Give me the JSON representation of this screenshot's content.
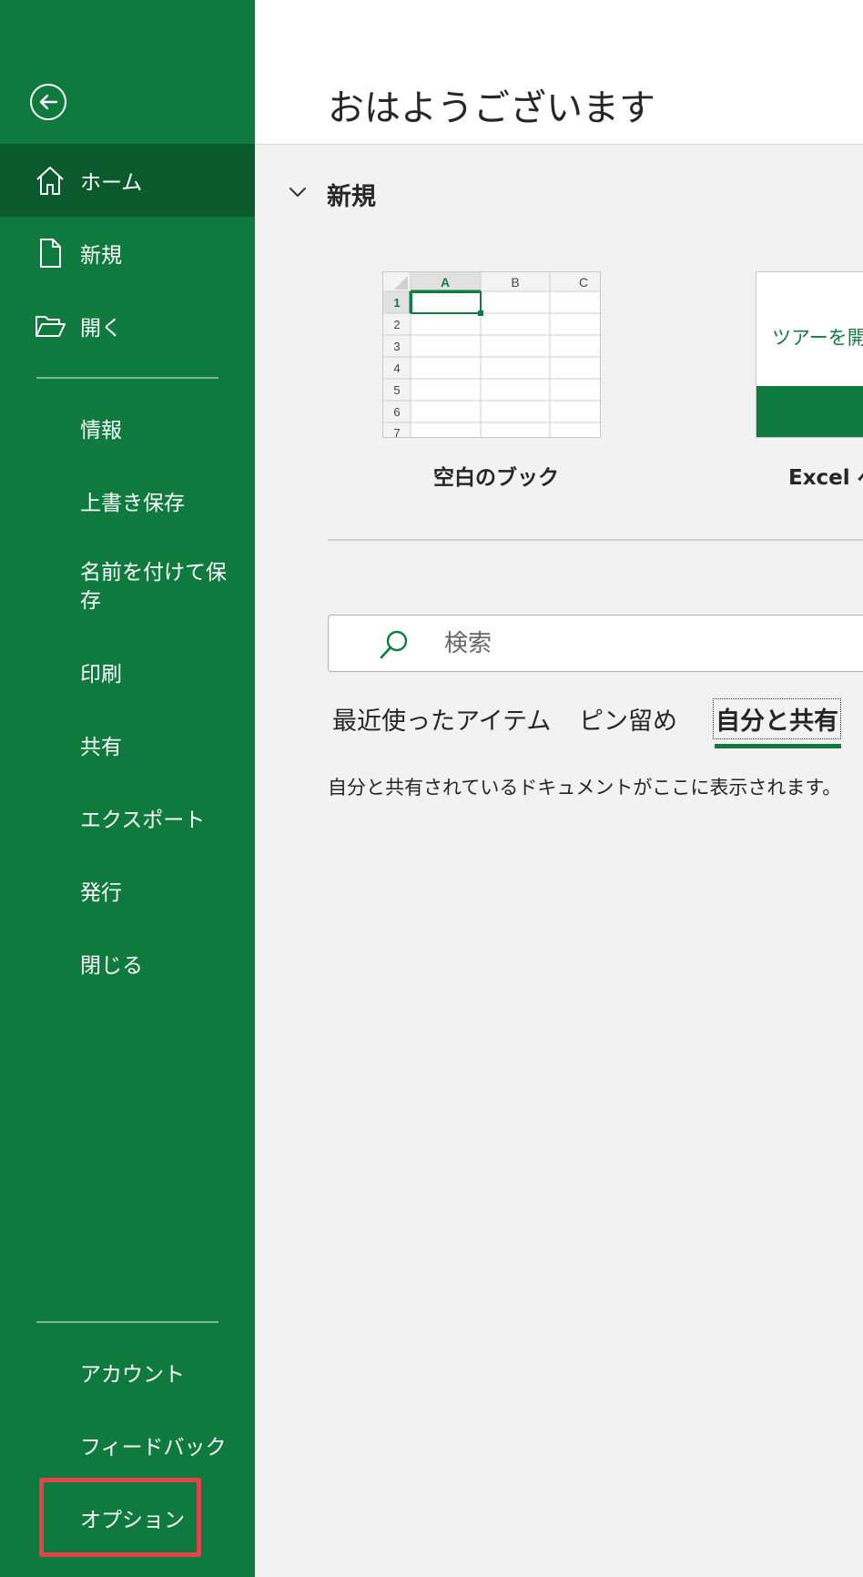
{
  "colors": {
    "sidebar_bg": "#0f7a3e",
    "sidebar_active": "#0a5a2d",
    "accent": "#0f7a3e",
    "highlight_box": "#e5434c"
  },
  "sidebar": {
    "back_icon": "back-arrow-icon",
    "primary_items": [
      {
        "label": "ホーム",
        "icon": "home-icon",
        "active": true
      },
      {
        "label": "新規",
        "icon": "new-document-icon"
      },
      {
        "label": "開く",
        "icon": "open-folder-icon"
      }
    ],
    "secondary_items": [
      {
        "label": "情報"
      },
      {
        "label": "上書き保存"
      },
      {
        "label": "名前を付けて保存"
      },
      {
        "label": "印刷"
      },
      {
        "label": "共有"
      },
      {
        "label": "エクスポート"
      },
      {
        "label": "発行"
      },
      {
        "label": "閉じる"
      }
    ],
    "bottom_items": [
      {
        "label": "アカウント"
      },
      {
        "label": "フィードバック"
      },
      {
        "label": "オプション",
        "highlighted": true
      }
    ]
  },
  "main": {
    "greeting": "おはようございます",
    "new_section": {
      "title": "新規",
      "templates": [
        {
          "label": "空白のブック",
          "columns": [
            "A",
            "B",
            "C"
          ],
          "rows": [
            "1",
            "2",
            "3",
            "4",
            "5",
            "6",
            "7"
          ]
        },
        {
          "label": "Excel へ",
          "card_text": "ツアーを開"
        }
      ]
    },
    "search": {
      "placeholder": "検索",
      "icon": "search-icon"
    },
    "tabs": [
      {
        "label": "最近使ったアイテム"
      },
      {
        "label": "ピン留め"
      },
      {
        "label": "自分と共有",
        "active": true
      }
    ],
    "empty_message": "自分と共有されているドキュメントがここに表示されます。"
  }
}
